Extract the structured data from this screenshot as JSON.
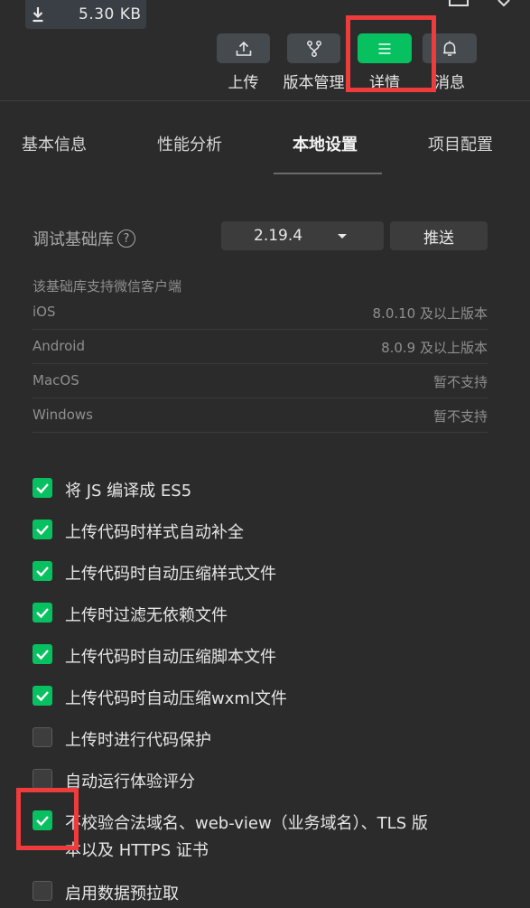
{
  "toolbar": {
    "download_size": "5.30 KB",
    "buttons": [
      {
        "label": "上传",
        "icon": "upload-icon"
      },
      {
        "label": "版本管理",
        "icon": "branch-icon"
      },
      {
        "label": "详情",
        "icon": "menu-icon"
      },
      {
        "label": "消息",
        "icon": "bell-icon"
      }
    ],
    "active_button": "详情",
    "accent_color": "#07c160",
    "highlight_color": "#ee3b3b"
  },
  "tabs": [
    {
      "label": "基本信息"
    },
    {
      "label": "性能分析"
    },
    {
      "label": "本地设置"
    },
    {
      "label": "项目配置"
    }
  ],
  "active_tab": "本地设置",
  "sdk": {
    "label": "调试基础库",
    "help_icon": "?",
    "version": "2.19.4",
    "push_label": "推送",
    "support_title": "该基础库支持微信客户端",
    "support": [
      {
        "os": "iOS",
        "version": "8.0.10 及以上版本"
      },
      {
        "os": "Android",
        "version": "8.0.9 及以上版本"
      },
      {
        "os": "MacOS",
        "version": "暂不支持"
      },
      {
        "os": "Windows",
        "version": "暂不支持"
      }
    ]
  },
  "options": [
    {
      "label": "将 JS 编译成 ES5",
      "checked": true
    },
    {
      "label": "上传代码时样式自动补全",
      "checked": true
    },
    {
      "label": "上传代码时自动压缩样式文件",
      "checked": true
    },
    {
      "label": "上传时过滤无依赖文件",
      "checked": true
    },
    {
      "label": "上传代码时自动压缩脚本文件",
      "checked": true
    },
    {
      "label": "上传代码时自动压缩wxml文件",
      "checked": true
    },
    {
      "label": "上传时进行代码保护",
      "checked": false
    },
    {
      "label": "自动运行体验评分",
      "checked": false
    },
    {
      "label_line1": "不校验合法域名、web-view（业务域名）、TLS 版",
      "label_line2": "本以及 HTTPS 证书",
      "checked": true
    },
    {
      "label": "启用数据预拉取",
      "checked": false
    }
  ]
}
